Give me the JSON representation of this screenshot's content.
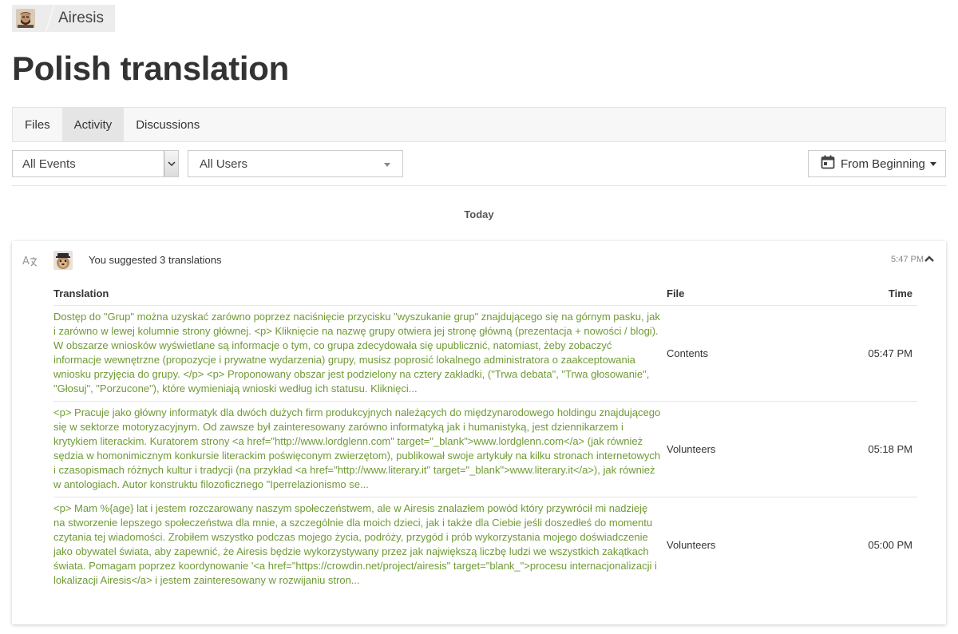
{
  "breadcrumb": {
    "project": "Airesis"
  },
  "page": {
    "title": "Polish translation"
  },
  "tabs": [
    {
      "label": "Files",
      "active": false
    },
    {
      "label": "Activity",
      "active": true
    },
    {
      "label": "Discussions",
      "active": false
    }
  ],
  "filters": {
    "events_selected": "All Events",
    "users_selected": "All Users",
    "date_label": "From Beginning"
  },
  "day_label": "Today",
  "activity": {
    "summary": "You suggested 3 translations",
    "time": "5:47 PM",
    "columns": {
      "translation": "Translation",
      "file": "File",
      "time": "Time"
    },
    "rows": [
      {
        "translation": "Dostęp do \"Grup\" można uzyskać zarówno poprzez naciśnięcie przycisku \"wyszukanie grup\" znajdującego się na górnym pasku, jak i zarówno w lewej kolumnie strony głównej. <p> Kliknięcie na nazwę grupy otwiera jej stronę główną (prezentacja + nowości / blogi). W obszarze wniosków wyświetlane są informacje o tym, co grupa zdecydowała się upublicznić, natomiast, żeby zobaczyć informacje wewnętrzne (propozycje i prywatne wydarzenia) grupy, musisz poprosić lokalnego administratora o zaakceptowania wniosku przyjęcia do grupy. </p> <p> Proponowany obszar jest podzielony na cztery zakładki, (\"Trwa debata\", \"Trwa głosowanie\", \"Głosuj\", \"Porzucone\"), które wymieniają wnioski według ich statusu. Kliknięci...",
        "file": "Contents",
        "time": "05:47 PM"
      },
      {
        "translation": "<p> Pracuje jako główny informatyk dla dwóch dużych firm produkcyjnych należących do międzynarodowego holdingu znajdującego się w sektorze motoryzacyjnym. Od zawsze był zainteresowany zarówno informatyką jak i humanistyką, jest dziennikarzem i krytykiem literackim. Kuratorem strony <a href=\"http://www.lordglenn.com\" target=\"_blank\">www.lordglenn.com</a> (jak również sędzia w homonimicznym konkursie literackim poświęconym zwierzętom), publikował swoje artykuły na kilku stronach internetowych i czasopismach różnych kultur i tradycji (na przykład <a href=\"http://www.literary.it\" target=\"_blank\">www.literary.it</a>), jak również w antologiach. Autor konstruktu filozoficznego \"Iperrelazionismo se...",
        "file": "Volunteers",
        "time": "05:18 PM"
      },
      {
        "translation": "<p> Mam %{age} lat i jestem rozczarowany naszym społeczeństwem, ale w Airesis znalazłem powód który przywrócił mi nadzieję na stworzenie lepszego społeczeństwa dla mnie, a szczególnie dla moich dzieci, jak i także dla Ciebie jeśli doszedłeś do momentu czytania tej wiadomości. Zrobiłem wszystko podczas mojego życia, podróży, przygód i prób wykorzystania mojego doświadczenie jako obywatel świata, aby zapewnić, że Airesis będzie wykorzystywany przez jak największą liczbę ludzi we wszystkich zakątkach świata. Pomagam poprzez koordynowanie '<a href=\"https://crowdin.net/project/airesis\" target=\"blank_\">procesu internacjonalizacji i lokalizacji Airesis</a> i jestem zainteresowany w rozwijaniu stron...",
        "file": "Volunteers",
        "time": "05:00 PM"
      }
    ]
  },
  "icons": {
    "translate": "translate-icon",
    "calendar": "calendar-icon",
    "collapse": "chevron-up-icon"
  },
  "colors": {
    "translation_text": "#6f9a34",
    "active_tab": "#e5e5e5"
  }
}
